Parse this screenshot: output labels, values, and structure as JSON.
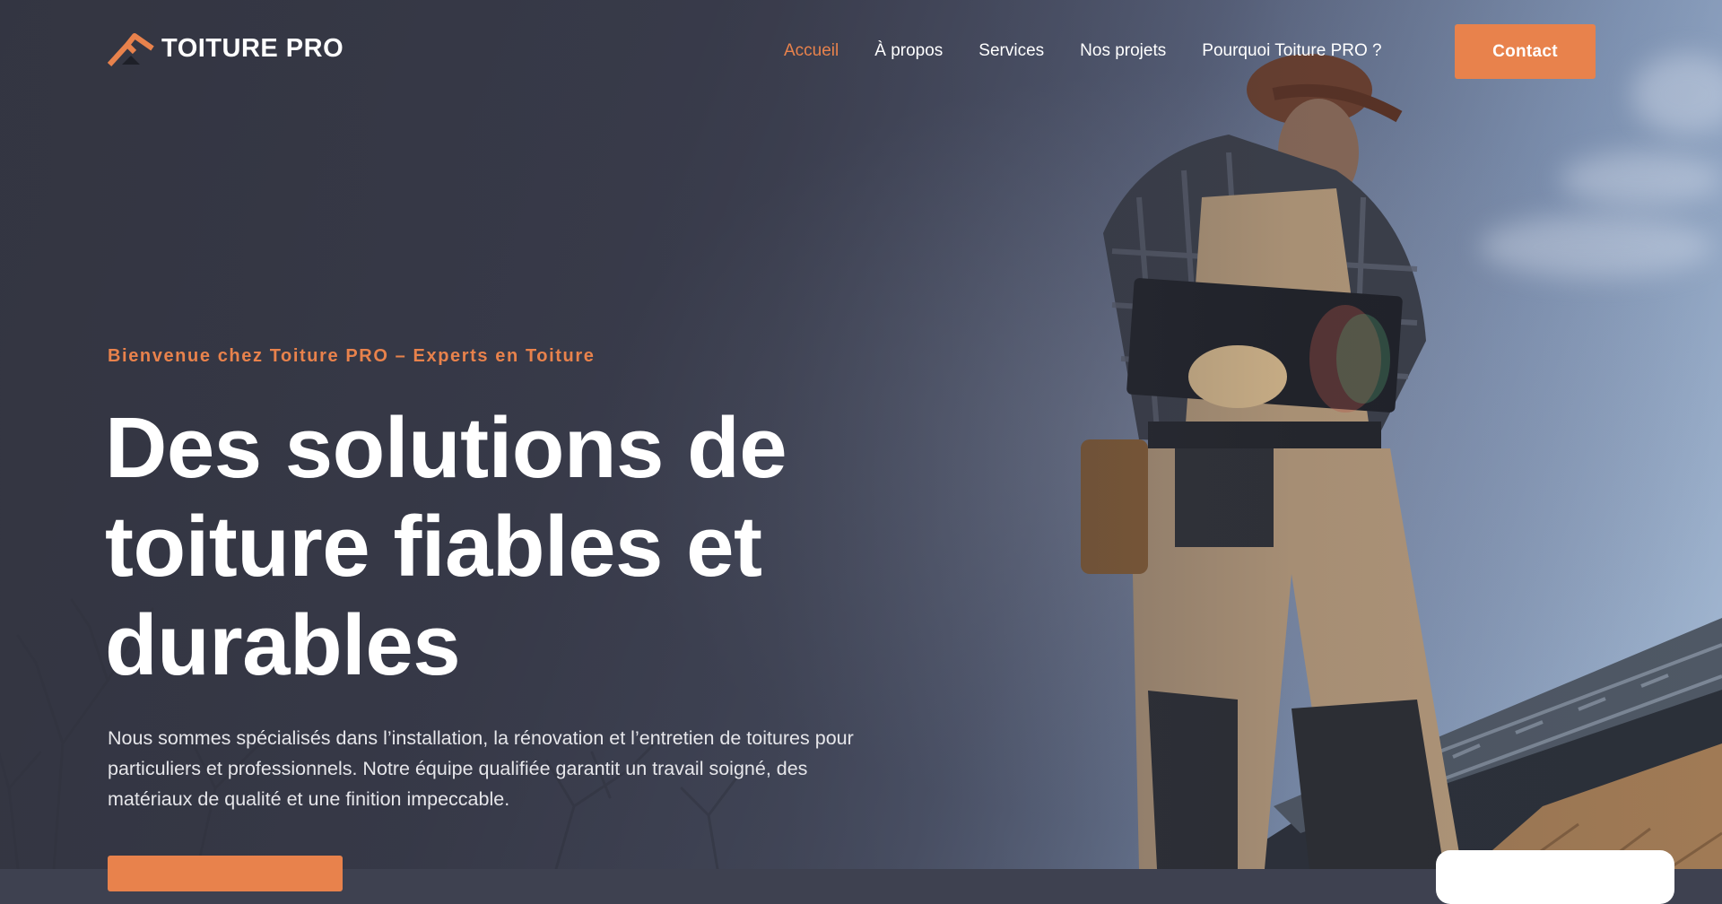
{
  "brand": {
    "name": "TOITURE PRO",
    "logo_icon": "roof-logo-icon",
    "accent_color": "#e8824c"
  },
  "nav": {
    "items": [
      {
        "label": "Accueil",
        "active": true
      },
      {
        "label": "À propos",
        "active": false
      },
      {
        "label": "Services",
        "active": false
      },
      {
        "label": "Nos projets",
        "active": false
      },
      {
        "label": "Pourquoi Toiture PRO ?",
        "active": false
      }
    ],
    "contact_label": "Contact"
  },
  "hero": {
    "eyebrow": "Bienvenue chez Toiture PRO – Experts en Toiture",
    "headline_lines": [
      "Des solutions de",
      "toiture fiables et",
      "durables"
    ],
    "lead": "Nous sommes spécialisés dans l’installation, la rénovation et l’entretien de toitures pour particuliers et professionnels. Notre équipe qualifiée garantit un travail soigné, des matériaux de qualité et une finition impeccable."
  }
}
